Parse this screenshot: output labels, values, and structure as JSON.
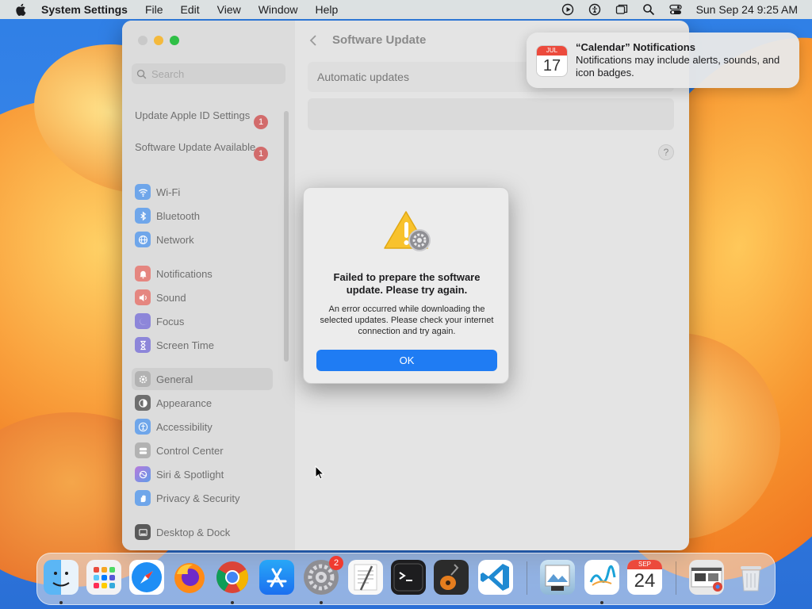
{
  "menubar": {
    "app_name": "System Settings",
    "menus": [
      "File",
      "Edit",
      "View",
      "Window",
      "Help"
    ],
    "datetime": "Sun Sep 24  9:25 AM"
  },
  "window": {
    "title": "Software Update",
    "search_placeholder": "Search",
    "alerts": [
      {
        "label": "Update Apple ID Settings",
        "badge": "1"
      },
      {
        "label": "Software Update Available",
        "badge": "1"
      }
    ],
    "sidebar_groups": [
      [
        {
          "label": "Wi-Fi",
          "icon": "wifi-icon",
          "color": "#2f8cf0"
        },
        {
          "label": "Bluetooth",
          "icon": "bluetooth-icon",
          "color": "#2f8cf0"
        },
        {
          "label": "Network",
          "icon": "globe-icon",
          "color": "#2f8cf0"
        }
      ],
      [
        {
          "label": "Notifications",
          "icon": "bell-icon",
          "color": "#e8453c"
        },
        {
          "label": "Sound",
          "icon": "speaker-icon",
          "color": "#e8453c"
        },
        {
          "label": "Focus",
          "icon": "moon-icon",
          "color": "#5b4fd3"
        },
        {
          "label": "Screen Time",
          "icon": "hourglass-icon",
          "color": "#5b4fd3"
        }
      ],
      [
        {
          "label": "General",
          "icon": "gear-icon",
          "color": "#8e8e93",
          "selected": true
        },
        {
          "label": "Appearance",
          "icon": "appearance-icon",
          "color": "#1d1d1f"
        },
        {
          "label": "Accessibility",
          "icon": "accessibility-icon",
          "color": "#2f8cf0"
        },
        {
          "label": "Control Center",
          "icon": "control-center-icon",
          "color": "#8e8e93"
        },
        {
          "label": "Siri & Spotlight",
          "icon": "siri-icon",
          "color": "#b04fd8"
        },
        {
          "label": "Privacy & Security",
          "icon": "hand-icon",
          "color": "#2f8cf0"
        }
      ],
      [
        {
          "label": "Desktop & Dock",
          "icon": "dock-icon",
          "color": "#1d1d1f"
        }
      ]
    ],
    "auto_updates_label": "Automatic updates",
    "help_label": "?"
  },
  "dialog": {
    "title": "Failed to prepare the software update. Please try again.",
    "message": "An error occurred while downloading the selected updates. Please check your internet connection and try again.",
    "ok_label": "OK"
  },
  "notification": {
    "title": "“Calendar” Notifications",
    "body": "Notifications may include alerts, sounds, and icon badges.",
    "cal_month": "JUL",
    "cal_day": "17"
  },
  "dock": {
    "settings_badge": "2",
    "calendar_month": "SEP",
    "calendar_day": "24"
  }
}
